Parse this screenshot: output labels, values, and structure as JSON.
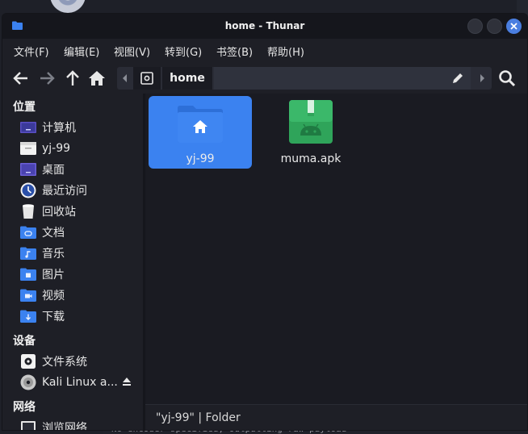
{
  "window": {
    "title": "home - Thunar"
  },
  "menu": [
    "文件(F)",
    "编辑(E)",
    "视图(V)",
    "转到(G)",
    "书签(B)",
    "帮助(H)"
  ],
  "pathbar": {
    "current": "home"
  },
  "sidebar": {
    "places_title": "位置",
    "places": [
      {
        "label": "计算机",
        "icon": "computer-icon"
      },
      {
        "label": "yj-99",
        "icon": "home-folder-icon"
      },
      {
        "label": "桌面",
        "icon": "desktop-icon"
      },
      {
        "label": "最近访问",
        "icon": "recent-icon"
      },
      {
        "label": "回收站",
        "icon": "trash-icon"
      },
      {
        "label": "文档",
        "icon": "documents-folder-icon"
      },
      {
        "label": "音乐",
        "icon": "music-folder-icon"
      },
      {
        "label": "图片",
        "icon": "pictures-folder-icon"
      },
      {
        "label": "视频",
        "icon": "videos-folder-icon"
      },
      {
        "label": "下载",
        "icon": "downloads-folder-icon"
      }
    ],
    "devices_title": "设备",
    "devices": [
      {
        "label": "文件系统",
        "icon": "filesystem-icon"
      },
      {
        "label": "Kali Linux a...",
        "icon": "optical-disc-icon"
      }
    ],
    "network_title": "网络",
    "network": [
      {
        "label": "浏览网络",
        "icon": "network-icon"
      }
    ]
  },
  "files": [
    {
      "name": "yj-99",
      "type": "folder",
      "selected": true
    },
    {
      "name": "muma.apk",
      "type": "apk",
      "selected": false
    }
  ],
  "status": {
    "text": "\"yj-99\" | Folder"
  },
  "background": {
    "terminal_line": "No encoder specified, outputting raw payload"
  },
  "colors": {
    "accent": "#3b82f0",
    "apk": "#2fa45a"
  }
}
